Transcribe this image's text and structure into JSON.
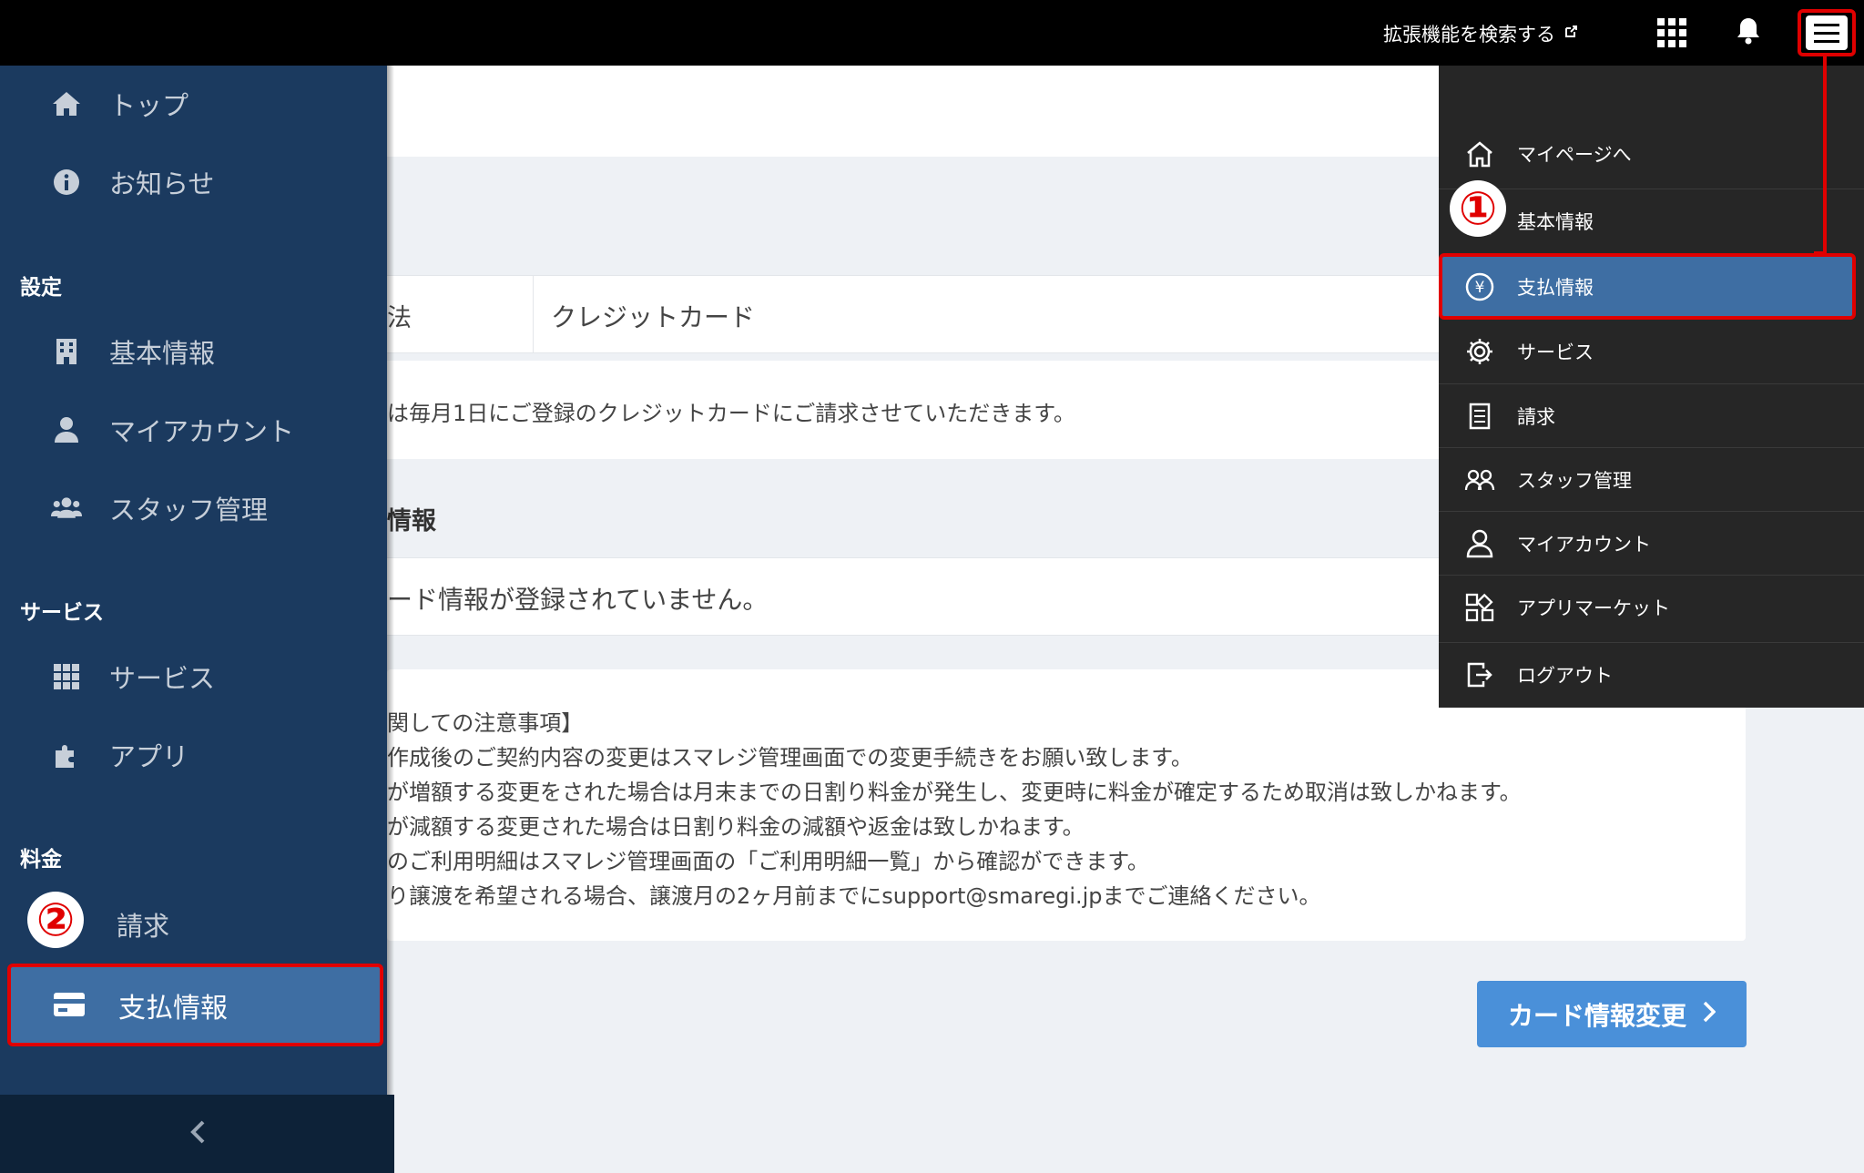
{
  "header": {
    "ext_search_label": "拡張機能を検索する",
    "icons": [
      "external-link-icon",
      "grid-icon",
      "bell-icon",
      "hamburger-menu-icon"
    ]
  },
  "sidebar": {
    "items_top": [
      {
        "label": "トップ",
        "icon": "home-icon"
      },
      {
        "label": "お知らせ",
        "icon": "info-icon"
      }
    ],
    "sections": {
      "settings": "設定",
      "service": "サービス",
      "fee": "料金"
    },
    "settings_items": [
      {
        "label": "基本情報",
        "icon": "building-icon"
      },
      {
        "label": "マイアカウント",
        "icon": "user-icon"
      },
      {
        "label": "スタッフ管理",
        "icon": "users-icon"
      }
    ],
    "service_items": [
      {
        "label": "サービス",
        "icon": "grid-icon"
      },
      {
        "label": "アプリ",
        "icon": "puzzle-icon"
      }
    ],
    "fee_items": [
      {
        "label": "請求",
        "icon": "document-icon"
      }
    ],
    "active_item": {
      "label": "支払情報",
      "icon": "credit-card-icon"
    },
    "badge_2": "②",
    "collapse_icon": "chevron-left-icon"
  },
  "main": {
    "payment_method_label_fragment": "法",
    "payment_method_value": "クレジットカード",
    "billing_note": "は毎月1日にご登録のクレジットカードにご請求させていただきます。",
    "card_section_title_fragment": "情報",
    "card_empty_message": "ード情報が登録されていません。",
    "notes": [
      "関しての注意事項】",
      "作成後のご契約内容の変更はスマレジ管理画面での変更手続きをお願い致します。",
      "が増額する変更をされた場合は月末までの日割り料金が発生し、変更時に料金が確定するため取消は致しかねます。",
      "が減額する変更された場合は日割り料金の減額や返金は致しかねます。",
      "のご利用明細はスマレジ管理画面の「ご利用明細一覧」から確認ができます。",
      "り譲渡を希望される場合、譲渡月の2ヶ月前までにsupport@smaregi.jpまでご連絡ください。"
    ],
    "cta_label": "カード情報変更"
  },
  "dropdown": {
    "items": [
      {
        "label": "マイページへ",
        "icon": "home-outline-icon"
      },
      {
        "label": "基本情報",
        "icon": "building-outline-icon"
      },
      {
        "label": "支払情報",
        "icon": "yen-circle-icon"
      },
      {
        "label": "サービス",
        "icon": "gear-icon"
      },
      {
        "label": "請求",
        "icon": "document-icon"
      },
      {
        "label": "スタッフ管理",
        "icon": "users-outline-icon"
      },
      {
        "label": "マイアカウント",
        "icon": "user-outline-icon"
      },
      {
        "label": "アプリマーケット",
        "icon": "apps-icon"
      },
      {
        "label": "ログアウト",
        "icon": "logout-icon"
      }
    ],
    "badge_1": "①"
  },
  "colors": {
    "topbar": "#000000",
    "sidebar": "#1b3a5f",
    "active": "#3e6ea3",
    "highlight": "#e00000",
    "cta": "#4a90d9",
    "dropdown": "#262626"
  }
}
